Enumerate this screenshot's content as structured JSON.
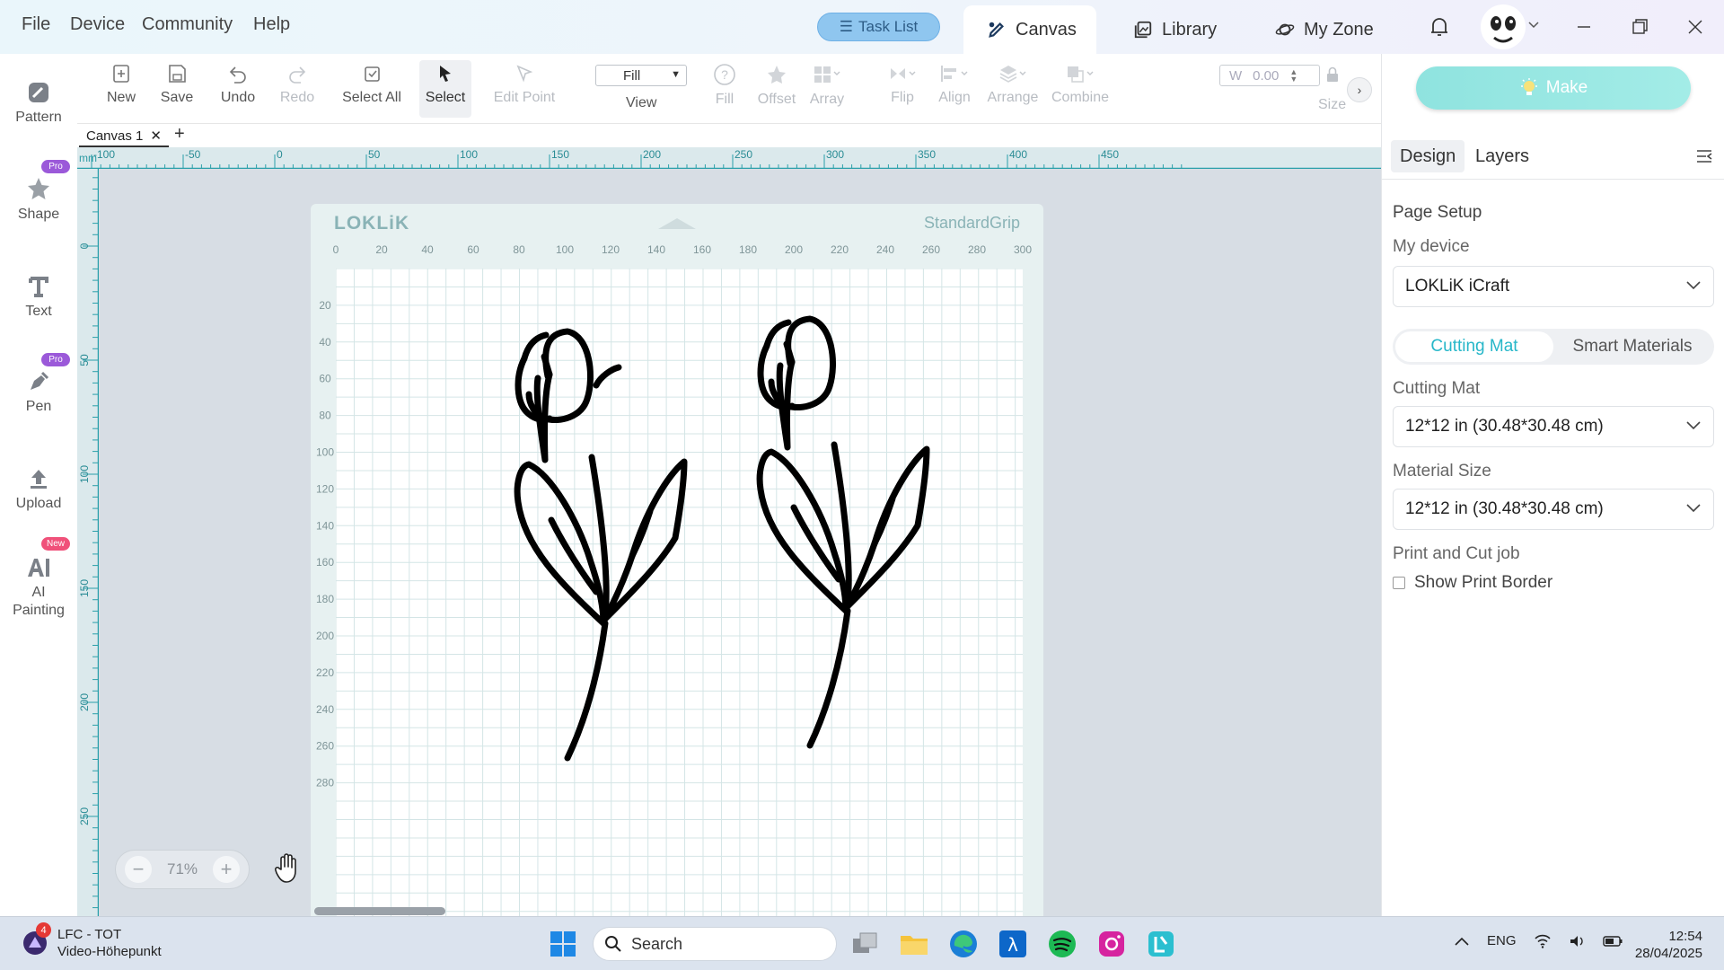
{
  "menu": {
    "file": "File",
    "device": "Device",
    "community": "Community",
    "help": "Help"
  },
  "task_list": "Task List",
  "top_tabs": {
    "canvas": "Canvas",
    "library": "Library",
    "my_zone": "My Zone"
  },
  "rail": {
    "pattern": "Pattern",
    "shape": "Shape",
    "text": "Text",
    "pen": "Pen",
    "upload": "Upload",
    "ai_painting_1": "AI",
    "ai_painting_2": "Painting",
    "pro": "Pro",
    "new": "New"
  },
  "toolbar": {
    "new": "New",
    "save": "Save",
    "undo": "Undo",
    "redo": "Redo",
    "select_all": "Select All",
    "select": "Select",
    "edit_point": "Edit Point",
    "view_value": "Fill",
    "view_label": "View",
    "fill": "Fill",
    "offset": "Offset",
    "array": "Array",
    "flip": "Flip",
    "align": "Align",
    "arrange": "Arrange",
    "combine": "Combine",
    "w_label": "W",
    "w_value": "0.00",
    "size_label": "Size"
  },
  "canvas_tab": {
    "label": "Canvas 1"
  },
  "ruler_top": {
    "unit": "mm",
    "ticks": [
      "-100",
      "-50",
      "0",
      "50",
      "100",
      "150",
      "200",
      "250",
      "300",
      "350",
      "400",
      "450"
    ]
  },
  "ruler_left": {
    "ticks": [
      "0",
      "50",
      "100",
      "150",
      "200",
      "250"
    ]
  },
  "mat": {
    "logo": "LOKLiK",
    "grip": "StandardGrip",
    "x_ticks": [
      "0",
      "20",
      "40",
      "60",
      "80",
      "100",
      "120",
      "140",
      "160",
      "180",
      "200",
      "220",
      "240",
      "260",
      "280",
      "300"
    ],
    "y_ticks": [
      "20",
      "40",
      "60",
      "80",
      "100",
      "120",
      "140",
      "160",
      "180",
      "200",
      "220",
      "240",
      "260",
      "280"
    ]
  },
  "zoom": {
    "value": "71%",
    "minus": "−",
    "plus": "+"
  },
  "right_panel": {
    "make": "Make",
    "tab_design": "Design",
    "tab_layers": "Layers",
    "page_setup": "Page Setup",
    "my_device_label": "My device",
    "my_device_value": "LOKLiK iCraft",
    "seg_cutting_mat": "Cutting Mat",
    "seg_smart_materials": "Smart Materials",
    "cutting_mat_label": "Cutting Mat",
    "cutting_mat_value": "12*12 in (30.48*30.48 cm)",
    "material_size_label": "Material Size",
    "material_size_value": "12*12 in (30.48*30.48 cm)",
    "print_cut_label": "Print and Cut job",
    "show_print_border": "Show Print Border"
  },
  "taskbar": {
    "news_title": "LFC - TOT",
    "news_subtitle": "Video-Höhepunkt",
    "news_badge": "4",
    "search": "Search",
    "lang": "ENG",
    "time": "12:54",
    "date": "28/04/2025"
  },
  "colors": {
    "accent": "#27b7c9",
    "make": "#9be8e3",
    "task_list": "#8fc6ef"
  }
}
